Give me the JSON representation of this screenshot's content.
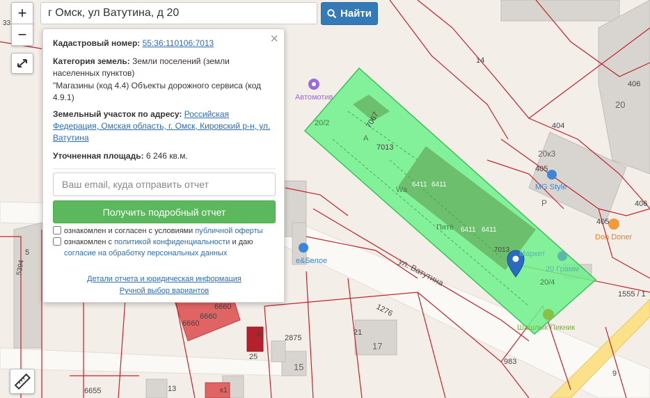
{
  "search": {
    "value": "г Омск, ул Ватутина, д 20",
    "button_label": "Найти"
  },
  "zoom": {
    "in_label": "+",
    "out_label": "−"
  },
  "panel": {
    "cadastral_label": "Кадастровый номер:",
    "cadastral_value": "55:36:110106:7013",
    "category_label": "Категория земель:",
    "category_value": "Земли поселений (земли населенных пунктов)",
    "usage_value": "\"Магазины (код 4.4) Объекты дорожного сервиса (код 4.9.1)",
    "address_label": "Земельный участок по адресу:",
    "address_value": "Российская Федерация, Омская область, г. Омск, Кировский р-н, ул. Ватутина",
    "area_label": "Уточненная площадь:",
    "area_value": "6 246 кв.м.",
    "email_placeholder": "Ваш email, куда отправить отчет",
    "report_button": "Получить подробный отчет",
    "consent1_text": "ознакомлен и согласен с условиями",
    "consent1_link": "публичной оферты",
    "consent2_text": "ознакомлен с",
    "consent2_link": "политикой конфиденциальности",
    "consent2_tail": "и даю",
    "consent2_link2": "согласие на обработку персональных данных",
    "details_link": "Детали отчета и юридическая информация",
    "manual_link": "Ручной выбор вариантов",
    "close_glyph": "×"
  },
  "map": {
    "parcel_color": "#6ef08c",
    "building_color": "#6cbf6c",
    "boundary_color": "#c0242c",
    "street_label": "ул. Ватутина",
    "labels": {
      "l14": "14",
      "l406a": "406",
      "l20": "20",
      "l404": "404",
      "l405a": "405",
      "l20k3": "20к3",
      "l406b": "406",
      "l405b": "405",
      "l1555": "1555 / 1",
      "l983": "983",
      "l9": "9",
      "l1276": "1276",
      "l20_2": "20/2",
      "l7013a": "7013",
      "l7067": "7067",
      "lA": "А",
      "l6411a": "6411",
      "l6411b": "6411",
      "l6411c": "6411",
      "l6411d": "6411",
      "l7013b": "7013",
      "l20_4": "20/4",
      "lP": "Р",
      "l33": "33",
      "l5": "5",
      "l5394": "5394",
      "l6660a": "6660",
      "l6660b": "6660",
      "l6660c": "6660",
      "l2875": "2875",
      "l21": "21",
      "l17": "17",
      "l15": "15",
      "l25": "25",
      "l6655": "6655",
      "l13": "13",
      "lk1": "к1",
      "lWa": "Wa",
      "lPyat": "Пятё",
      "lA2": "А"
    },
    "pois": {
      "avtomotiv": "Автомотив",
      "mgstyle": "MG Style",
      "dondoner": "Don Doner",
      "market": "Маркет",
      "gramm": "20 Грамм",
      "shashlyk": "Шашлык Пикник",
      "beloe": "е&Белое"
    }
  }
}
